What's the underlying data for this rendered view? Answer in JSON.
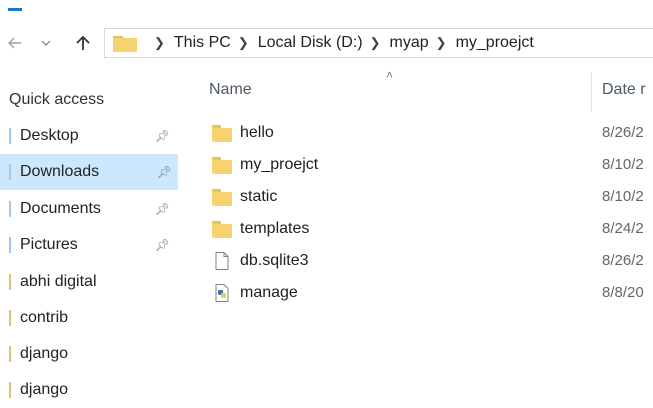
{
  "address": {
    "crumbs": [
      "This PC",
      "Local Disk (D:)",
      "myap",
      "my_proejct"
    ]
  },
  "nav": {
    "back_icon": "left-arrow-icon",
    "recent_icon": "chevron-down-icon",
    "up_icon": "up-arrow-icon"
  },
  "sidebar": {
    "quick_access_label": "Quick access",
    "items": [
      {
        "label": "Desktop",
        "pinned": true
      },
      {
        "label": "Downloads",
        "pinned": true,
        "selected": true
      },
      {
        "label": "Documents",
        "pinned": true
      },
      {
        "label": "Pictures",
        "pinned": true
      },
      {
        "label": "abhi digital",
        "pinned": false
      },
      {
        "label": "contrib",
        "pinned": false
      },
      {
        "label": "django",
        "pinned": false
      },
      {
        "label": "django",
        "pinned": false
      }
    ]
  },
  "columns": {
    "name": "Name",
    "date": "Date r"
  },
  "files": [
    {
      "name": "hello",
      "type": "folder",
      "date": "8/26/2"
    },
    {
      "name": "my_proejct",
      "type": "folder",
      "date": "8/10/2"
    },
    {
      "name": "static",
      "type": "folder",
      "date": "8/10/2"
    },
    {
      "name": "templates",
      "type": "folder",
      "date": "8/24/2"
    },
    {
      "name": "db.sqlite3",
      "type": "file",
      "date": "8/26/2"
    },
    {
      "name": "manage",
      "type": "python",
      "date": "8/8/20"
    }
  ],
  "colors": {
    "accent": "#1979ca",
    "selection": "#cce8ff",
    "folder": "#f6d273"
  }
}
